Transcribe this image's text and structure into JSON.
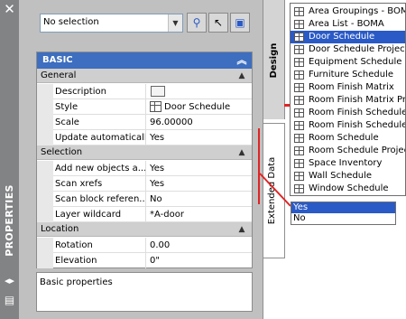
{
  "window": {
    "title": "PROPERTIES",
    "close_glyph": "✕",
    "autohide_icon": "autohide-icon",
    "menu_icon": "palette-menu-icon"
  },
  "toolbar": {
    "selection_value": "No selection",
    "buttons": [
      {
        "name": "quick-select-icon",
        "glyph": "⚲"
      },
      {
        "name": "select-objects-icon",
        "glyph": "↖"
      },
      {
        "name": "toggle-pickadd-icon",
        "glyph": "▣"
      }
    ]
  },
  "basic": {
    "header": "BASIC",
    "collapse_glyph": "︽",
    "general": {
      "label": "General",
      "rows": [
        {
          "label": "Description",
          "value": ""
        },
        {
          "label": "Style",
          "value": "Door Schedule"
        },
        {
          "label": "Scale",
          "value": "96.00000"
        },
        {
          "label": "Update automatically",
          "value": "Yes"
        }
      ]
    },
    "selection": {
      "label": "Selection",
      "rows": [
        {
          "label": "Add new objects a...",
          "value": "Yes"
        },
        {
          "label": "Scan xrefs",
          "value": "Yes"
        },
        {
          "label": "Scan block referen...",
          "value": "No"
        },
        {
          "label": "Layer wildcard",
          "value": "*A-door"
        }
      ]
    },
    "location": {
      "label": "Location",
      "rows": [
        {
          "label": "Rotation",
          "value": "0.00"
        },
        {
          "label": "Elevation",
          "value": "0\""
        }
      ]
    },
    "description_text": "Basic properties"
  },
  "tabs": {
    "design": "Design",
    "extended_data": "Extended Data"
  },
  "style_list": {
    "items": [
      "Area Groupings - BOMA",
      "Area List - BOMA",
      "Door Schedule",
      "Door Schedule Project",
      "Equipment Schedule",
      "Furniture Schedule",
      "Room Finish Matrix",
      "Room Finish Matrix Pro",
      "Room Finish Schedule",
      "Room Finish Schedule I",
      "Room Schedule",
      "Room Schedule Project",
      "Space Inventory",
      "Wall Schedule",
      "Window Schedule"
    ],
    "selected_index": 2
  },
  "yes_no_list": {
    "items": [
      "Yes",
      "No"
    ],
    "selected_index": 0
  },
  "colors": {
    "header_blue": "#3d6ebf",
    "selection_blue": "#2a5ac6",
    "annotation_red": "#e02424",
    "palette_gray": "#c0c0c0"
  }
}
